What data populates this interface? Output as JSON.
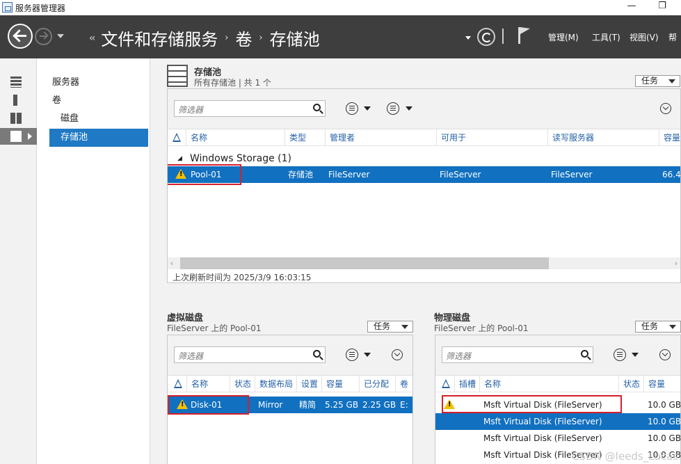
{
  "window": {
    "title": "服务器管理器",
    "minimize_glyph": "—",
    "restore_glyph": "❐"
  },
  "header": {
    "breadcrumb": [
      "文件和存储服务",
      "卷",
      "存储池"
    ],
    "breadcrumb_lead": "‹‹",
    "breadcrumb_sep": "›",
    "menus": [
      "管理(M)",
      "工具(T)",
      "视图(V)",
      "帮"
    ]
  },
  "sidebar": {
    "icons": [
      "dashboard-icon",
      "local-server-icon",
      "all-servers-icon",
      "file-storage-icon"
    ],
    "items": [
      {
        "label": "服务器",
        "active": false
      },
      {
        "label": "卷",
        "active": false
      },
      {
        "label": "磁盘",
        "active": false
      },
      {
        "label": "存储池",
        "active": true
      }
    ]
  },
  "storage_pools": {
    "title": "存储池",
    "subtitle": "所有存储池 | 共 1 个",
    "tasks_label": "任务",
    "filter_placeholder": "筛选器",
    "columns": [
      "名称",
      "类型",
      "管理者",
      "可用于",
      "读写服务器",
      "容量"
    ],
    "group": "Windows Storage (1)",
    "rows": [
      {
        "name": "Pool-01",
        "type": "存储池",
        "managed_by": "FileServer",
        "available_to": "FileServer",
        "rw_server": "FileServer",
        "capacity": "66.4",
        "warning": true,
        "selected": true
      }
    ],
    "last_refresh": "上次刷新时间为 2025/3/9 16:03:15"
  },
  "virtual_disks": {
    "title": "虚拟磁盘",
    "subtitle": "FileServer 上的 Pool-01",
    "tasks_label": "任务",
    "filter_placeholder": "筛选器",
    "columns": [
      "名称",
      "状态",
      "数据布局",
      "设置",
      "容量",
      "已分配",
      "卷"
    ],
    "rows": [
      {
        "name": "Disk-01",
        "status": "",
        "layout": "Mirror",
        "provisioning": "精简",
        "capacity": "5.25 GB",
        "allocated": "2.25 GB",
        "volume": "E:",
        "warning": true,
        "selected": true
      }
    ]
  },
  "physical_disks": {
    "title": "物理磁盘",
    "subtitle": "FileServer 上的 Pool-01",
    "tasks_label": "任务",
    "filter_placeholder": "筛选器",
    "columns": [
      "插槽",
      "名称",
      "状态",
      "容量"
    ],
    "rows": [
      {
        "name": "Msft Virtual Disk (FileServer)",
        "capacity": "10.0 GB",
        "warning": true,
        "selected": false
      },
      {
        "name": "Msft Virtual Disk (FileServer)",
        "capacity": "10.0 GB",
        "warning": false,
        "selected": true
      },
      {
        "name": "Msft Virtual Disk (FileServer)",
        "capacity": "10.0 GB",
        "warning": false,
        "selected": false
      },
      {
        "name": "Msft Virtual Disk (FileServer)",
        "capacity": "10.0 GB",
        "warning": false,
        "selected": false
      }
    ]
  },
  "watermark": "CSDN @leeds_Lucas",
  "colors": {
    "header_bg": "#3e3e3e",
    "selection": "#1170c0",
    "nav_active": "#1f79c4",
    "highlight_box": "#d4202a",
    "warning": "#f2c200"
  }
}
